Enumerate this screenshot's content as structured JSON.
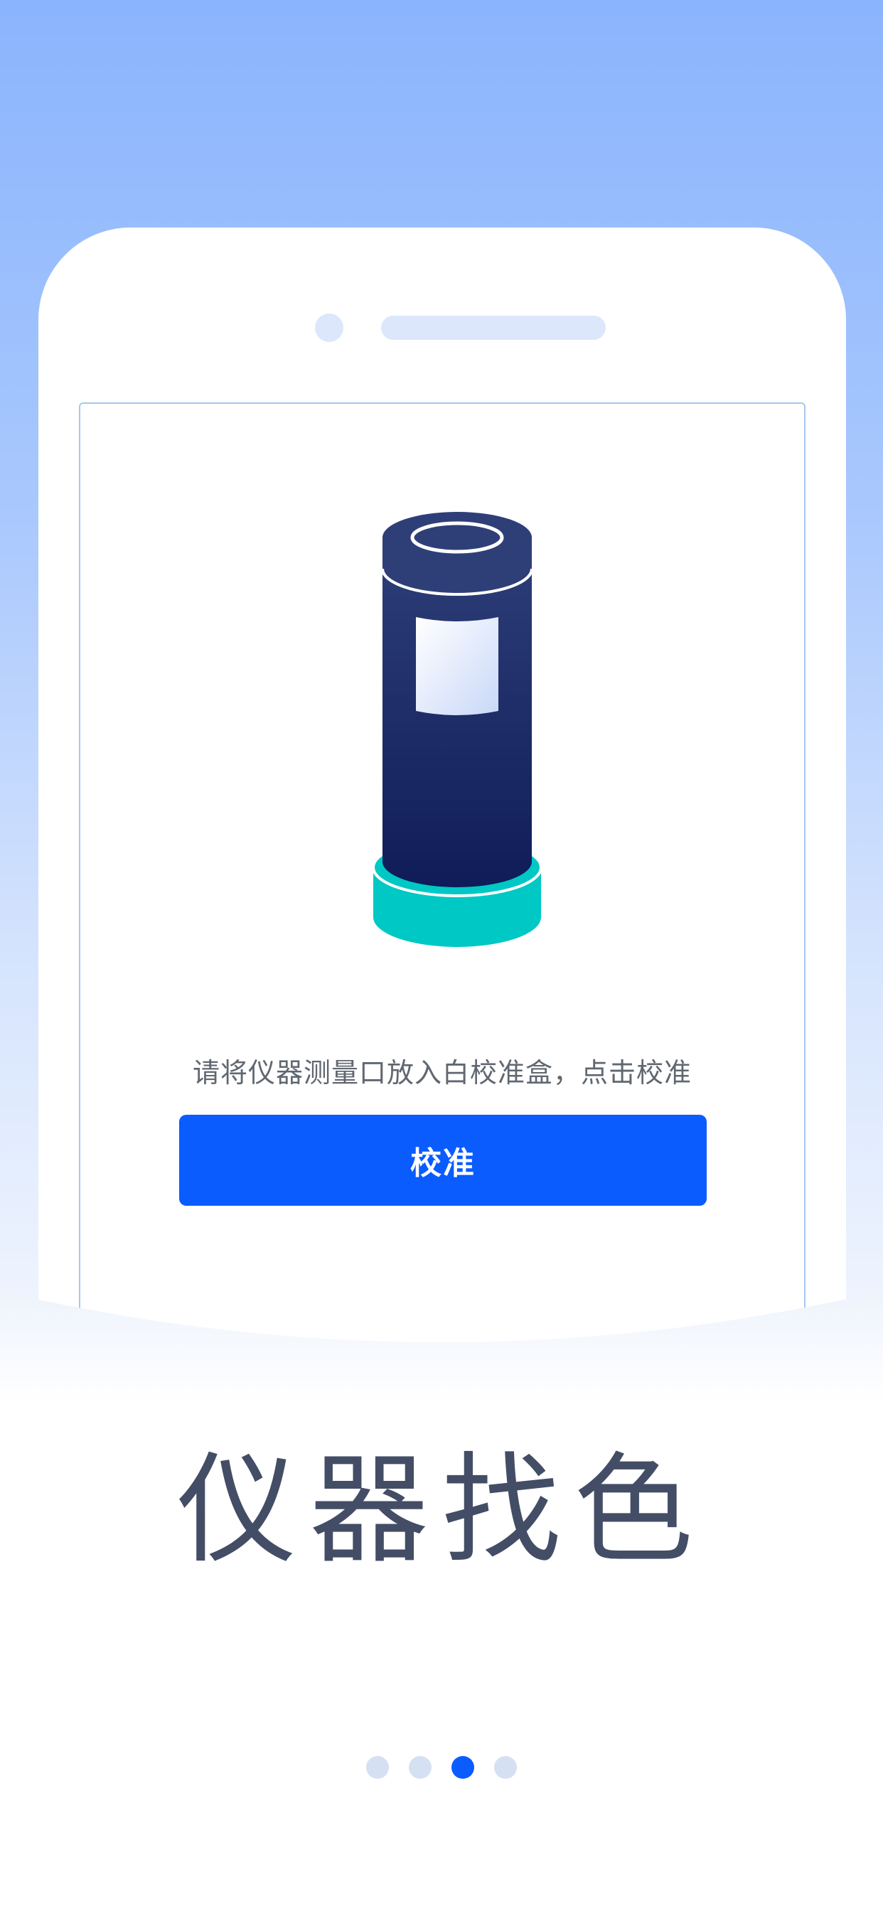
{
  "screen": {
    "instruction": "请将仪器测量口放入白校准盒，点击校准",
    "calibrate_button": "校准"
  },
  "page": {
    "title": "仪器找色"
  },
  "pager": {
    "total": 4,
    "active_index": 2
  },
  "colors": {
    "accent": "#0a5cff",
    "title_text": "#444d66",
    "device_dark": "#1a2a63",
    "device_base": "#00c8c4",
    "background_top": "#8ab4fd"
  }
}
